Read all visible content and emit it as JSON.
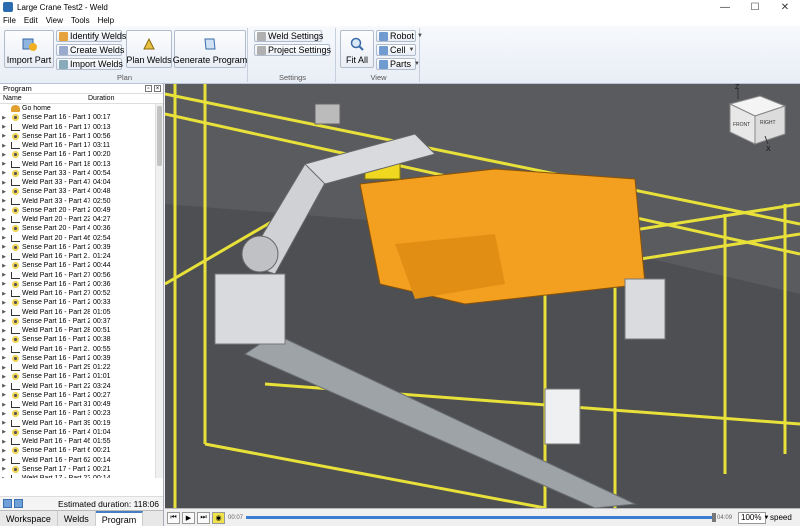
{
  "window": {
    "title": "Large Crane Test2 - Weld",
    "minimize": "—",
    "maximize": "☐",
    "close": "✕"
  },
  "menu": [
    "File",
    "Edit",
    "View",
    "Tools",
    "Help"
  ],
  "ribbon": {
    "import_part": "Import Part",
    "identify_welds": "Identify Welds",
    "create_welds": "Create Welds",
    "import_welds": "Import Welds",
    "plan_welds": "Plan Welds",
    "generate_program": "Generate Program",
    "plan_group": "Plan",
    "weld_settings": "Weld Settings",
    "project_settings": "Project Settings",
    "settings_group": "Settings",
    "fit_all": "Fit All",
    "robot": "Robot",
    "cell": "Cell",
    "parts": "Parts",
    "view_group": "View"
  },
  "panel": {
    "title": "Program",
    "col_name": "Name",
    "col_duration": "Duration",
    "rows": [
      {
        "icon": "home",
        "name": "Go home",
        "dur": ""
      },
      {
        "icon": "eye",
        "name": "Sense Part 16 - Part 1...",
        "dur": "00:17"
      },
      {
        "icon": "weld",
        "name": "Weld Part 16 - Part 17...",
        "dur": "00:13"
      },
      {
        "icon": "eye",
        "name": "Sense Part 16 - Part 1...",
        "dur": "00:56"
      },
      {
        "icon": "weld",
        "name": "Weld Part 16 - Part 17...",
        "dur": "03:11"
      },
      {
        "icon": "eye",
        "name": "Sense Part 16 - Part 1...",
        "dur": "00:20"
      },
      {
        "icon": "weld",
        "name": "Weld Part 16 - Part 18...",
        "dur": "00:13"
      },
      {
        "icon": "eye",
        "name": "Sense Part 33 - Part 4...",
        "dur": "00:54"
      },
      {
        "icon": "weld",
        "name": "Weld Part 33 - Part 47...",
        "dur": "04:04"
      },
      {
        "icon": "eye",
        "name": "Sense Part 33 - Part 4...",
        "dur": "00:48"
      },
      {
        "icon": "weld",
        "name": "Weld Part 33 - Part 47...",
        "dur": "02:50"
      },
      {
        "icon": "eye",
        "name": "Sense Part 20 - Part 2...",
        "dur": "00:49"
      },
      {
        "icon": "weld",
        "name": "Weld Part 20 - Part 22...",
        "dur": "04:27"
      },
      {
        "icon": "eye",
        "name": "Sense Part 20 - Part 4...",
        "dur": "00:36"
      },
      {
        "icon": "weld",
        "name": "Weld Part 20 - Part 46...",
        "dur": "02:54"
      },
      {
        "icon": "eye",
        "name": "Sense Part 16 - Part 2...",
        "dur": "00:39"
      },
      {
        "icon": "weld",
        "name": "Weld Part 16 - Part 2...",
        "dur": "01:24"
      },
      {
        "icon": "eye",
        "name": "Sense Part 16 - Part 2...",
        "dur": "00:44"
      },
      {
        "icon": "weld",
        "name": "Weld Part 16 - Part 27...",
        "dur": "00:56"
      },
      {
        "icon": "eye",
        "name": "Sense Part 16 - Part 2...",
        "dur": "00:36"
      },
      {
        "icon": "weld",
        "name": "Weld Part 16 - Part 27...",
        "dur": "00:52"
      },
      {
        "icon": "eye",
        "name": "Sense Part 16 - Part 2...",
        "dur": "00:33"
      },
      {
        "icon": "weld",
        "name": "Weld Part 16 - Part 28...",
        "dur": "01:05"
      },
      {
        "icon": "eye",
        "name": "Sense Part 16 - Part 2...",
        "dur": "00:37"
      },
      {
        "icon": "weld",
        "name": "Weld Part 16 - Part 28...",
        "dur": "00:51"
      },
      {
        "icon": "eye",
        "name": "Sense Part 16 - Part 2...",
        "dur": "00:38"
      },
      {
        "icon": "weld",
        "name": "Weld Part 16 - Part 2...",
        "dur": "00:55"
      },
      {
        "icon": "eye",
        "name": "Sense Part 16 - Part 2...",
        "dur": "00:39"
      },
      {
        "icon": "weld",
        "name": "Weld Part 16 - Part 29...",
        "dur": "01:22"
      },
      {
        "icon": "eye",
        "name": "Sense Part 16 - Part 2...",
        "dur": "01:01"
      },
      {
        "icon": "weld",
        "name": "Weld Part 16 - Part 22...",
        "dur": "03:24"
      },
      {
        "icon": "eye",
        "name": "Sense Part 16 - Part 2...",
        "dur": "00:27"
      },
      {
        "icon": "weld",
        "name": "Weld Part 16 - Part 31...",
        "dur": "00:49"
      },
      {
        "icon": "eye",
        "name": "Sense Part 16 - Part 3...",
        "dur": "00:23"
      },
      {
        "icon": "weld",
        "name": "Weld Part 16 - Part 39...",
        "dur": "00:19"
      },
      {
        "icon": "eye",
        "name": "Sense Part 16 - Part 4...",
        "dur": "01:04"
      },
      {
        "icon": "weld",
        "name": "Weld Part 16 - Part 46...",
        "dur": "01:55"
      },
      {
        "icon": "eye",
        "name": "Sense Part 16 - Part 6...",
        "dur": "00:21"
      },
      {
        "icon": "weld",
        "name": "Weld Part 16 - Part 62...",
        "dur": "00:14"
      },
      {
        "icon": "eye",
        "name": "Sense Part 17 - Part 2...",
        "dur": "00:21"
      },
      {
        "icon": "weld",
        "name": "Weld Part 17 - Part 22...",
        "dur": "00:14"
      },
      {
        "icon": "eye",
        "name": "Sense Part 17 - Part 2...",
        "dur": "00:25"
      },
      {
        "icon": "weld",
        "name": "Weld Part 17 - Part 27...",
        "dur": "00:18"
      },
      {
        "icon": "eye",
        "name": "Sense Part 17 - Part 2...",
        "dur": "00:17"
      }
    ],
    "estimated": "Estimated duration: 118:06",
    "tabs": [
      "Workspace",
      "Welds",
      "Program"
    ]
  },
  "player": {
    "time_start": "00:07",
    "time_end": "04:09",
    "zoom": "100%",
    "speed": "speed"
  },
  "axes": {
    "x": "X",
    "z": "Z",
    "front": "FRONT",
    "right": "RIGHT"
  }
}
